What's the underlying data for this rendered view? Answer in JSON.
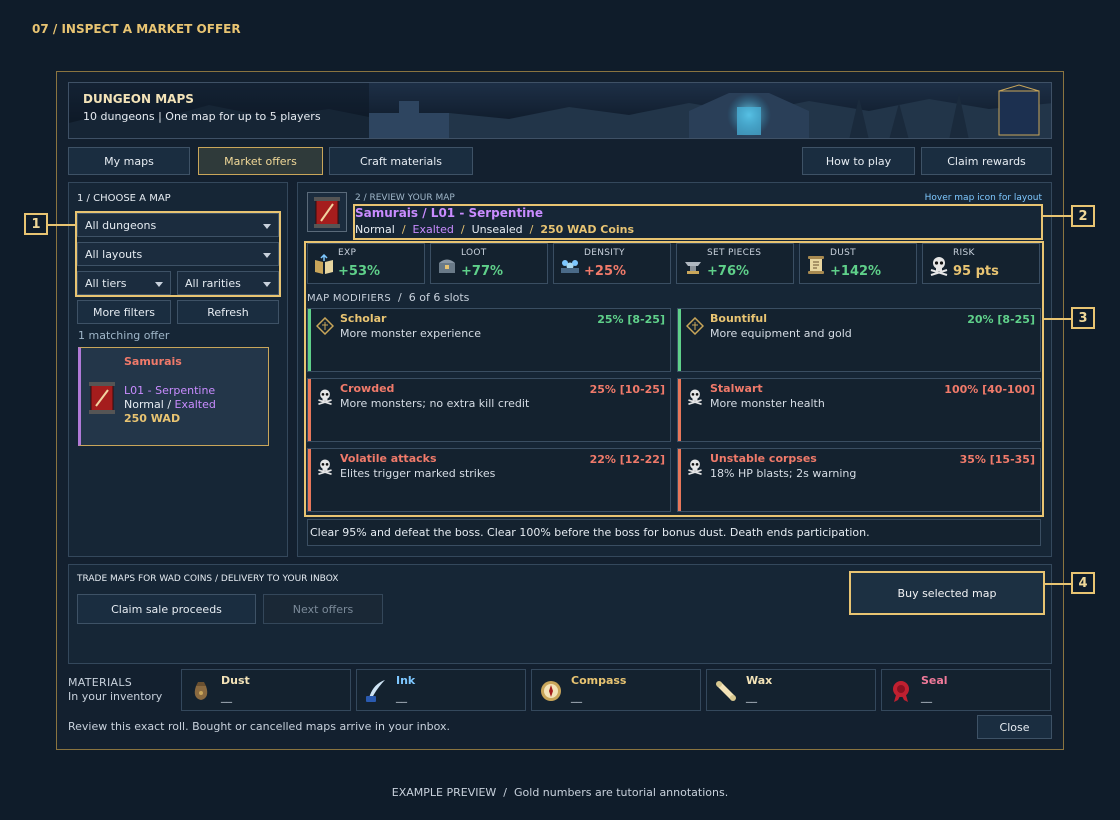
{
  "heading": "07 / INSPECT A MARKET OFFER",
  "banner": {
    "title": "DUNGEON MAPS",
    "subtitle": "10 dungeons | One map for up to 5 players"
  },
  "nav": {
    "tabs": [
      "My maps",
      "Market offers",
      "Craft materials"
    ],
    "active_tab": "Market offers",
    "right": [
      "How to play",
      "Claim rewards"
    ]
  },
  "choose": {
    "title": "1 / CHOOSE A MAP",
    "filters": {
      "dungeons": "All dungeons",
      "layouts": "All layouts",
      "tiers": "All tiers",
      "rarities": "All rarities"
    },
    "more_filters": "More filters",
    "refresh": "Refresh",
    "count": "1 matching offer",
    "offer": {
      "name": "Samurais",
      "map": "L01 - Serpentine",
      "tier": "Normal",
      "sep": "/",
      "rarity": "Exalted",
      "price": "250 WAD"
    }
  },
  "review": {
    "step": "2 / REVIEW YOUR MAP",
    "hint": "Hover map icon for layout",
    "title": "Samurais / L01 - Serpentine",
    "meta": {
      "tier": "Normal",
      "rarity": "Exalted",
      "seal": "Unsealed",
      "price": "250 WAD Coins",
      "sep": "/"
    },
    "stats": [
      {
        "label": "EXP",
        "value": "+53%",
        "icon": "book-icon",
        "color": "green"
      },
      {
        "label": "LOOT",
        "value": "+77%",
        "icon": "chest-icon",
        "color": "green"
      },
      {
        "label": "DENSITY",
        "value": "+25%",
        "icon": "crowd-icon",
        "color": "red"
      },
      {
        "label": "SET PIECES",
        "value": "+76%",
        "icon": "anvil-icon",
        "color": "green"
      },
      {
        "label": "DUST",
        "value": "+142%",
        "icon": "scroll-icon",
        "color": "green"
      },
      {
        "label": "RISK",
        "value": "95 pts",
        "icon": "skull-icon",
        "color": "gold"
      }
    ],
    "modifiers_title": "MAP MODIFIERS",
    "modifiers_sep": "/",
    "modifiers_slots": "6 of 6 slots",
    "modifiers": [
      {
        "name": "Scholar",
        "desc": "More monster experience",
        "roll": "25% [8-25]",
        "kind": "buff",
        "icon": "rune-icon"
      },
      {
        "name": "Bountiful",
        "desc": "More equipment and gold",
        "roll": "20% [8-25]",
        "kind": "buff",
        "icon": "rune-icon"
      },
      {
        "name": "Crowded",
        "desc": "More monsters; no extra kill credit",
        "roll": "25% [10-25]",
        "kind": "curse",
        "icon": "skull-icon"
      },
      {
        "name": "Stalwart",
        "desc": "More monster health",
        "roll": "100% [40-100]",
        "kind": "curse",
        "icon": "skull-icon"
      },
      {
        "name": "Volatile attacks",
        "desc": "Elites trigger marked strikes",
        "roll": "22% [12-22]",
        "kind": "curse",
        "icon": "skull-icon"
      },
      {
        "name": "Unstable corpses",
        "desc": "18% HP blasts; 2s warning",
        "roll": "35% [15-35]",
        "kind": "curse",
        "icon": "skull-icon"
      }
    ],
    "objective": "Clear 95% and defeat the boss. Clear 100% before the boss for bonus dust. Death ends participation."
  },
  "trade": {
    "title": "TRADE MAPS FOR WAD COINS / DELIVERY TO YOUR INBOX",
    "claim": "Claim sale proceeds",
    "next": "Next offers",
    "buy": "Buy selected map"
  },
  "materials": {
    "title": "MATERIALS",
    "subtitle": "In your inventory",
    "items": [
      {
        "name": "Dust",
        "value": "__",
        "icon": "dust-pouch-icon",
        "color": "#f3e3b8"
      },
      {
        "name": "Ink",
        "value": "__",
        "icon": "quill-icon",
        "color": "#7ec8ff"
      },
      {
        "name": "Compass",
        "value": "__",
        "icon": "compass-icon",
        "color": "#e8c472"
      },
      {
        "name": "Wax",
        "value": "__",
        "icon": "wax-scroll-icon",
        "color": "#f3e3b8"
      },
      {
        "name": "Seal",
        "value": "__",
        "icon": "seal-icon",
        "color": "#f07a9a"
      }
    ]
  },
  "footer": {
    "note": "Review this exact roll. Bought or cancelled maps arrive in your inbox.",
    "close": "Close"
  },
  "annotations": [
    "1",
    "2",
    "3",
    "4"
  ],
  "caption": "EXAMPLE PREVIEW  /  Gold numbers are tutorial annotations.",
  "colors": {
    "gold": "#e8c472",
    "buff": "#5fd08a",
    "curse": "#f07a6a",
    "exalted": "#c98cff",
    "frame": "#8a7440"
  }
}
